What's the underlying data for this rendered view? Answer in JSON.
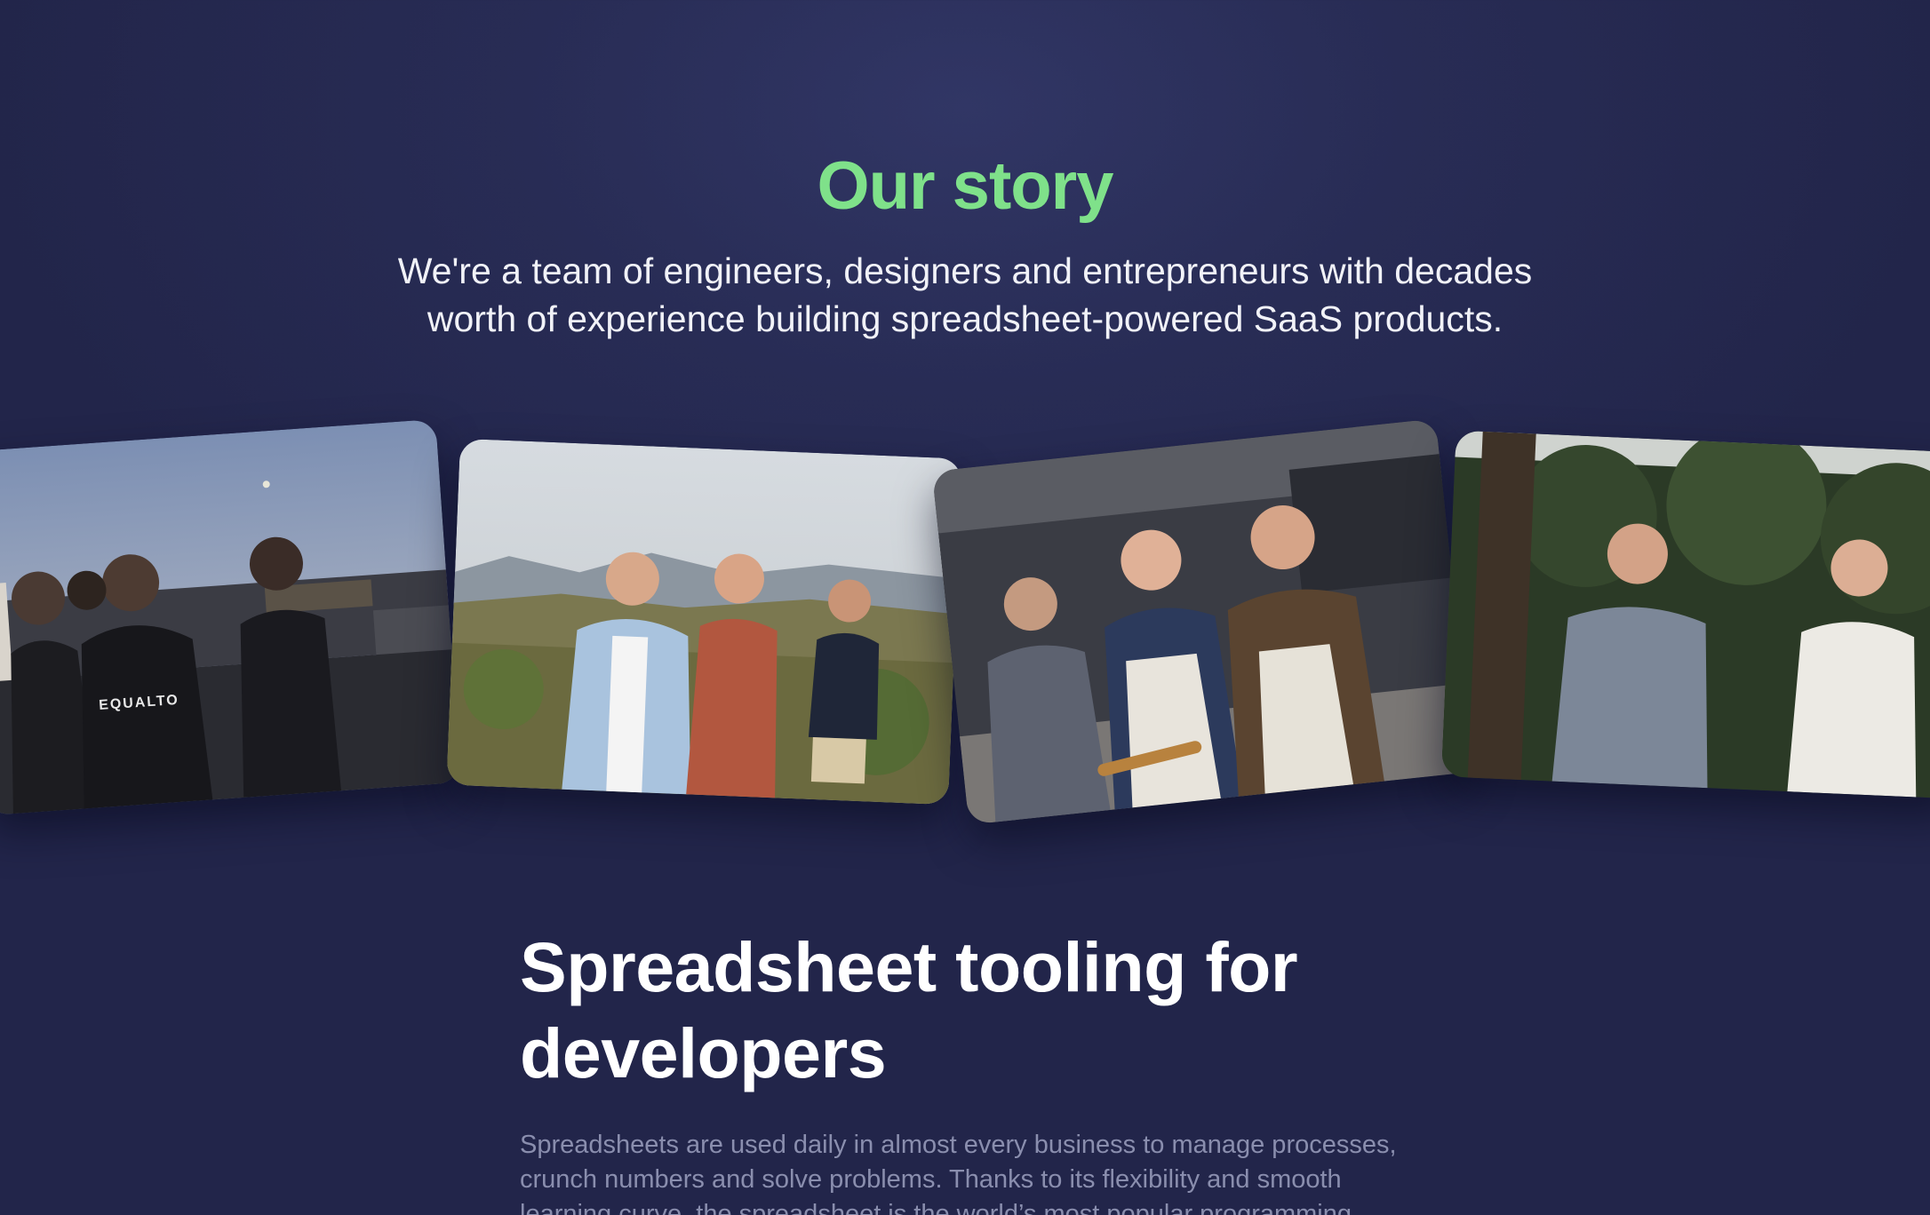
{
  "story": {
    "title": "Our story",
    "subtitle_line1": "We're a team of engineers, designers and entrepreneurs with decades",
    "subtitle_line2": "worth of experience building spreadsheet-powered SaaS products."
  },
  "photos": [
    {
      "name": "team-rooftop-photo",
      "hoodie_text": "EQUALTO"
    },
    {
      "name": "team-hiking-photo"
    },
    {
      "name": "team-cooking-photo"
    },
    {
      "name": "team-garden-photo"
    }
  ],
  "developers": {
    "title_line1": "Spreadsheet tooling for",
    "title_line2": "developers",
    "body_line1": "Spreadsheets are used daily in almost every business to manage processes,",
    "body_line2": "crunch numbers and solve problems. Thanks to its flexibility and smooth",
    "body_line3": "learning curve, the spreadsheet is the world’s most popular programming"
  },
  "colors": {
    "background": "#282c55",
    "accent_green": "#7fe18a",
    "muted_text": "#8a8eae"
  }
}
